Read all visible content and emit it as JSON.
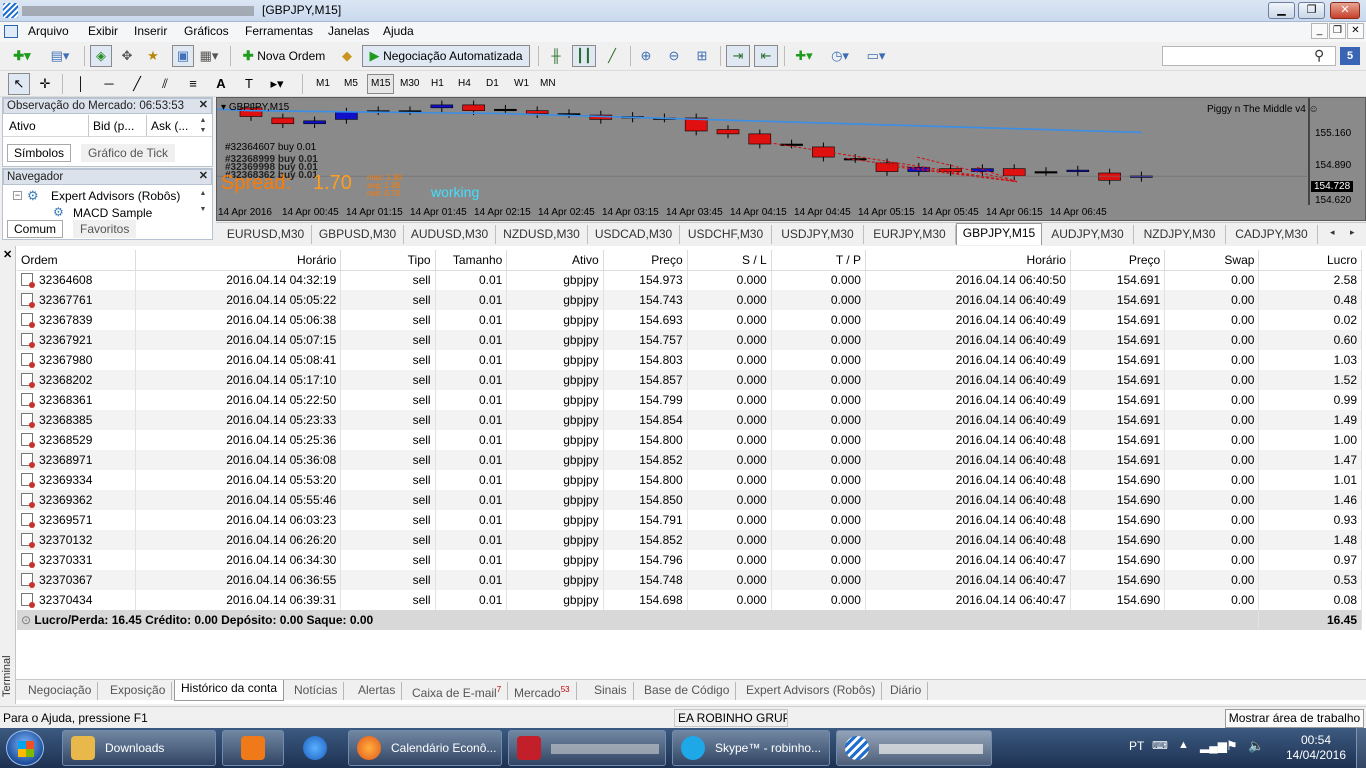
{
  "window": {
    "title": "[GBPJPY,M15]",
    "minimize": "▁",
    "restore": "❐",
    "close": "✕"
  },
  "menu": {
    "items": [
      "Arquivo",
      "Exibir",
      "Inserir",
      "Gráficos",
      "Ferramentas",
      "Janelas",
      "Ajuda"
    ]
  },
  "toolbar": {
    "new_order": "Nova Ordem",
    "autotrading": "Negociação Automatizada"
  },
  "timeframes": [
    "M1",
    "M5",
    "M15",
    "M30",
    "H1",
    "H4",
    "D1",
    "W1",
    "MN"
  ],
  "active_timeframe": "M15",
  "market_watch": {
    "title": "Observação do Mercado: 06:53:53",
    "columns": [
      "Ativo",
      "Bid (p...",
      "Ask (..."
    ],
    "tabs": [
      "Símbolos",
      "Gráfico de Tick"
    ]
  },
  "navigator": {
    "title": "Navegador",
    "items": [
      "Expert Advisors (Robôs)",
      "MACD Sample"
    ],
    "tabs": [
      "Comum",
      "Favoritos"
    ]
  },
  "chart": {
    "symbol": "GBPJPY,M15",
    "indicator": "Piggy n The Middle v4",
    "order_label": "#32364607 buy 0.01",
    "order_overlap": [
      "#32368999 buy 0.01",
      "#32369998 buy 0.01",
      "#32368362 buy 0.01"
    ],
    "spread_label": "Spread:",
    "spread_value": "1.70",
    "stats": [
      "max: 1.80",
      "avg: 1.48",
      "min: 0.70"
    ],
    "status": "working",
    "prices": [
      "155.160",
      "154.890",
      "154.728",
      "154.620"
    ],
    "time_labels": [
      "14 Apr 2016",
      "14 Apr 00:45",
      "14 Apr 01:15",
      "14 Apr 01:45",
      "14 Apr 02:15",
      "14 Apr 02:45",
      "14 Apr 03:15",
      "14 Apr 03:45",
      "14 Apr 04:15",
      "14 Apr 04:45",
      "14 Apr 05:15",
      "14 Apr 05:45",
      "14 Apr 06:15",
      "14 Apr 06:45"
    ]
  },
  "symbol_tabs": [
    "EURUSD,M30",
    "GBPUSD,M30",
    "AUDUSD,M30",
    "NZDUSD,M30",
    "USDCAD,M30",
    "USDCHF,M30",
    "USDJPY,M30",
    "EURJPY,M30",
    "GBPJPY,M15",
    "AUDJPY,M30",
    "NZDJPY,M30",
    "CADJPY,M30"
  ],
  "active_symbol_tab": "GBPJPY,M15",
  "terminal": {
    "side_label": "Terminal",
    "columns": [
      "Ordem",
      "Horário",
      "Tipo",
      "Tamanho",
      "Ativo",
      "Preço",
      "S / L",
      "T / P",
      "Horário",
      "Preço",
      "Swap",
      "Lucro"
    ],
    "rows": [
      [
        "32364608",
        "2016.04.14 04:32:19",
        "sell",
        "0.01",
        "gbpjpy",
        "154.973",
        "0.000",
        "0.000",
        "2016.04.14 06:40:50",
        "154.691",
        "0.00",
        "2.58"
      ],
      [
        "32367761",
        "2016.04.14 05:05:22",
        "sell",
        "0.01",
        "gbpjpy",
        "154.743",
        "0.000",
        "0.000",
        "2016.04.14 06:40:49",
        "154.691",
        "0.00",
        "0.48"
      ],
      [
        "32367839",
        "2016.04.14 05:06:38",
        "sell",
        "0.01",
        "gbpjpy",
        "154.693",
        "0.000",
        "0.000",
        "2016.04.14 06:40:49",
        "154.691",
        "0.00",
        "0.02"
      ],
      [
        "32367921",
        "2016.04.14 05:07:15",
        "sell",
        "0.01",
        "gbpjpy",
        "154.757",
        "0.000",
        "0.000",
        "2016.04.14 06:40:49",
        "154.691",
        "0.00",
        "0.60"
      ],
      [
        "32367980",
        "2016.04.14 05:08:41",
        "sell",
        "0.01",
        "gbpjpy",
        "154.803",
        "0.000",
        "0.000",
        "2016.04.14 06:40:49",
        "154.691",
        "0.00",
        "1.03"
      ],
      [
        "32368202",
        "2016.04.14 05:17:10",
        "sell",
        "0.01",
        "gbpjpy",
        "154.857",
        "0.000",
        "0.000",
        "2016.04.14 06:40:49",
        "154.691",
        "0.00",
        "1.52"
      ],
      [
        "32368361",
        "2016.04.14 05:22:50",
        "sell",
        "0.01",
        "gbpjpy",
        "154.799",
        "0.000",
        "0.000",
        "2016.04.14 06:40:49",
        "154.691",
        "0.00",
        "0.99"
      ],
      [
        "32368385",
        "2016.04.14 05:23:33",
        "sell",
        "0.01",
        "gbpjpy",
        "154.854",
        "0.000",
        "0.000",
        "2016.04.14 06:40:49",
        "154.691",
        "0.00",
        "1.49"
      ],
      [
        "32368529",
        "2016.04.14 05:25:36",
        "sell",
        "0.01",
        "gbpjpy",
        "154.800",
        "0.000",
        "0.000",
        "2016.04.14 06:40:48",
        "154.691",
        "0.00",
        "1.00"
      ],
      [
        "32368971",
        "2016.04.14 05:36:08",
        "sell",
        "0.01",
        "gbpjpy",
        "154.852",
        "0.000",
        "0.000",
        "2016.04.14 06:40:48",
        "154.691",
        "0.00",
        "1.47"
      ],
      [
        "32369334",
        "2016.04.14 05:53:20",
        "sell",
        "0.01",
        "gbpjpy",
        "154.800",
        "0.000",
        "0.000",
        "2016.04.14 06:40:48",
        "154.690",
        "0.00",
        "1.01"
      ],
      [
        "32369362",
        "2016.04.14 05:55:46",
        "sell",
        "0.01",
        "gbpjpy",
        "154.850",
        "0.000",
        "0.000",
        "2016.04.14 06:40:48",
        "154.690",
        "0.00",
        "1.46"
      ],
      [
        "32369571",
        "2016.04.14 06:03:23",
        "sell",
        "0.01",
        "gbpjpy",
        "154.791",
        "0.000",
        "0.000",
        "2016.04.14 06:40:48",
        "154.690",
        "0.00",
        "0.93"
      ],
      [
        "32370132",
        "2016.04.14 06:26:20",
        "sell",
        "0.01",
        "gbpjpy",
        "154.852",
        "0.000",
        "0.000",
        "2016.04.14 06:40:48",
        "154.690",
        "0.00",
        "1.48"
      ],
      [
        "32370331",
        "2016.04.14 06:34:30",
        "sell",
        "0.01",
        "gbpjpy",
        "154.796",
        "0.000",
        "0.000",
        "2016.04.14 06:40:47",
        "154.690",
        "0.00",
        "0.97"
      ],
      [
        "32370367",
        "2016.04.14 06:36:55",
        "sell",
        "0.01",
        "gbpjpy",
        "154.748",
        "0.000",
        "0.000",
        "2016.04.14 06:40:47",
        "154.690",
        "0.00",
        "0.53"
      ],
      [
        "32370434",
        "2016.04.14 06:39:31",
        "sell",
        "0.01",
        "gbpjpy",
        "154.698",
        "0.000",
        "0.000",
        "2016.04.14 06:40:47",
        "154.690",
        "0.00",
        "0.08"
      ]
    ],
    "summary": "Lucro/Perda: 16.45  Crédito: 0.00  Depósito: 0.00  Saque: 0.00",
    "summary_total": "16.45",
    "tabs": [
      {
        "label": "Negociação",
        "badge": ""
      },
      {
        "label": "Exposição",
        "badge": ""
      },
      {
        "label": "Histórico da conta",
        "badge": ""
      },
      {
        "label": "Notícias",
        "badge": ""
      },
      {
        "label": "Alertas",
        "badge": ""
      },
      {
        "label": "Caixa de E-mail",
        "badge": "7"
      },
      {
        "label": "Mercado",
        "badge": "53"
      },
      {
        "label": "Sinais",
        "badge": ""
      },
      {
        "label": "Base de Código",
        "badge": ""
      },
      {
        "label": "Expert Advisors (Robôs)",
        "badge": ""
      },
      {
        "label": "Diário",
        "badge": ""
      }
    ],
    "active_tab": "Histórico da conta"
  },
  "statusbar": {
    "help": "Para o Ajuda, pressione F1",
    "profile": "EA ROBINHO GRUPC"
  },
  "taskbar": {
    "tasks": [
      "Downloads",
      "",
      "",
      "Calendário Econô...",
      "",
      "Skype™ - robinho...",
      ""
    ],
    "show_desktop": "Mostrar área de trabalho",
    "lang": "PT",
    "time": "00:54",
    "date": "14/04/2016"
  },
  "colors": {
    "bull": "#1010c8",
    "bear": "#e01010",
    "chart_bg": "#8a8a8a",
    "ma_line": "#3a8ee6",
    "spread": "#ff7a00",
    "status": "#40e0ff"
  }
}
